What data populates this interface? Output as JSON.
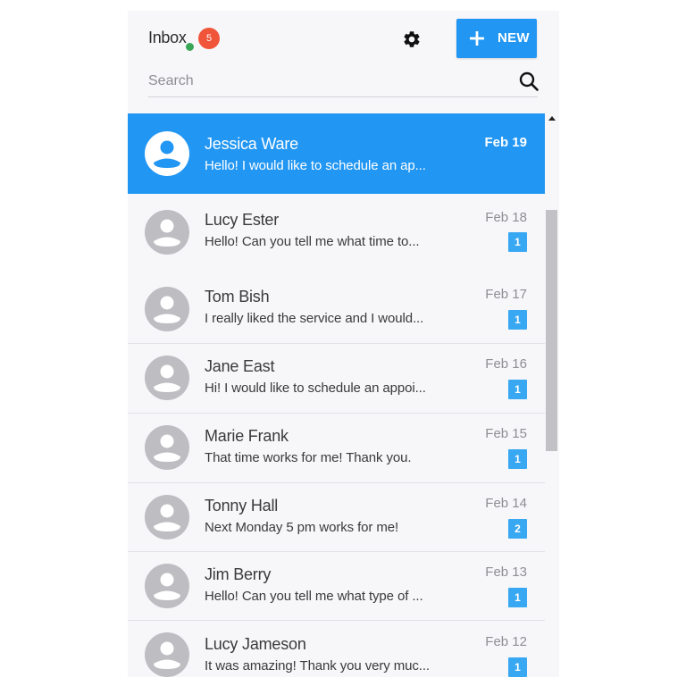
{
  "header": {
    "title": "Inbox",
    "unread_count": "5",
    "new_button_label": "NEW"
  },
  "search": {
    "placeholder": "Search",
    "value": ""
  },
  "colors": {
    "accent": "#2196f3",
    "badge": "#f0553a",
    "online": "#3aa757",
    "unread": "#39a8f2"
  },
  "conversations": [
    {
      "name": "Jessica Ware",
      "preview": "Hello! I would like to schedule an ap...",
      "date": "Feb 19",
      "unread": ""
    },
    {
      "name": "Lucy Ester",
      "preview": "Hello! Can you tell me what time to...",
      "date": "Feb 18",
      "unread": "1"
    },
    {
      "name": "Tom Bish",
      "preview": "I really liked the service and I would...",
      "date": "Feb 17",
      "unread": "1"
    },
    {
      "name": "Jane East",
      "preview": "Hi! I would like to schedule an appoi...",
      "date": "Feb 16",
      "unread": "1"
    },
    {
      "name": "Marie Frank",
      "preview": "That time works for me! Thank you.",
      "date": "Feb 15",
      "unread": "1"
    },
    {
      "name": "Tonny Hall",
      "preview": "Next Monday 5 pm works for me!",
      "date": "Feb 14",
      "unread": "2"
    },
    {
      "name": "Jim Berry",
      "preview": "Hello! Can you tell me what type of ...",
      "date": "Feb 13",
      "unread": "1"
    },
    {
      "name": "Lucy Jameson",
      "preview": "It was amazing! Thank you very muc...",
      "date": "Feb 12",
      "unread": "1"
    }
  ]
}
